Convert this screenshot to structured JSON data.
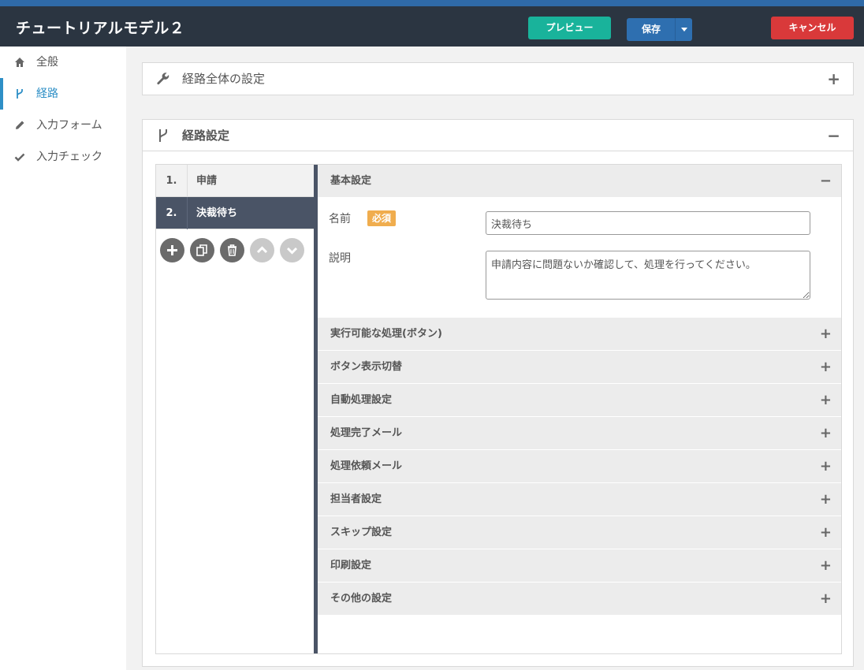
{
  "header": {
    "title": "チュートリアルモデル２",
    "preview_label": "プレビュー",
    "save_label": "保存",
    "cancel_label": "キャンセル"
  },
  "colors": {
    "header_bg": "#2b3541",
    "accent_blue": "#2e6fb0",
    "preview_green": "#19b39b",
    "cancel_red": "#d9393a",
    "required_orange": "#f0ad4e",
    "active_step": "#4a5466"
  },
  "sidebar": {
    "items": [
      {
        "label": "全般",
        "icon": "home-icon"
      },
      {
        "label": "経路",
        "icon": "branch-icon",
        "active": true
      },
      {
        "label": "入力フォーム",
        "icon": "pencil-icon"
      },
      {
        "label": "入力チェック",
        "icon": "check-icon"
      }
    ]
  },
  "panels": {
    "route_overall": {
      "title": "経路全体の設定",
      "icon": "wrench-icon",
      "toggle": "+"
    },
    "route_settings": {
      "title": "経路設定",
      "icon": "branch-icon",
      "toggle": "−"
    }
  },
  "steps": [
    {
      "num": "1.",
      "name": "申請"
    },
    {
      "num": "2.",
      "name": "決裁待ち",
      "active": true
    }
  ],
  "step_tools": [
    "add-icon",
    "copy-icon",
    "trash-icon",
    "move-up-icon",
    "move-down-icon"
  ],
  "basic": {
    "title": "基本設定",
    "toggle": "−",
    "name_label": "名前",
    "required_badge": "必須",
    "name_value": "決裁待ち",
    "desc_label": "説明",
    "desc_value": "申請内容に問題ないか確認して、処理を行ってください。"
  },
  "sections": [
    {
      "title": "実行可能な処理(ボタン)",
      "toggle": "+"
    },
    {
      "title": "ボタン表示切替",
      "toggle": "+"
    },
    {
      "title": "自動処理設定",
      "toggle": "+"
    },
    {
      "title": "処理完了メール",
      "toggle": "+"
    },
    {
      "title": "処理依頼メール",
      "toggle": "+"
    },
    {
      "title": "担当者設定",
      "toggle": "+"
    },
    {
      "title": "スキップ設定",
      "toggle": "+"
    },
    {
      "title": "印刷設定",
      "toggle": "+"
    },
    {
      "title": "その他の設定",
      "toggle": "+"
    }
  ]
}
